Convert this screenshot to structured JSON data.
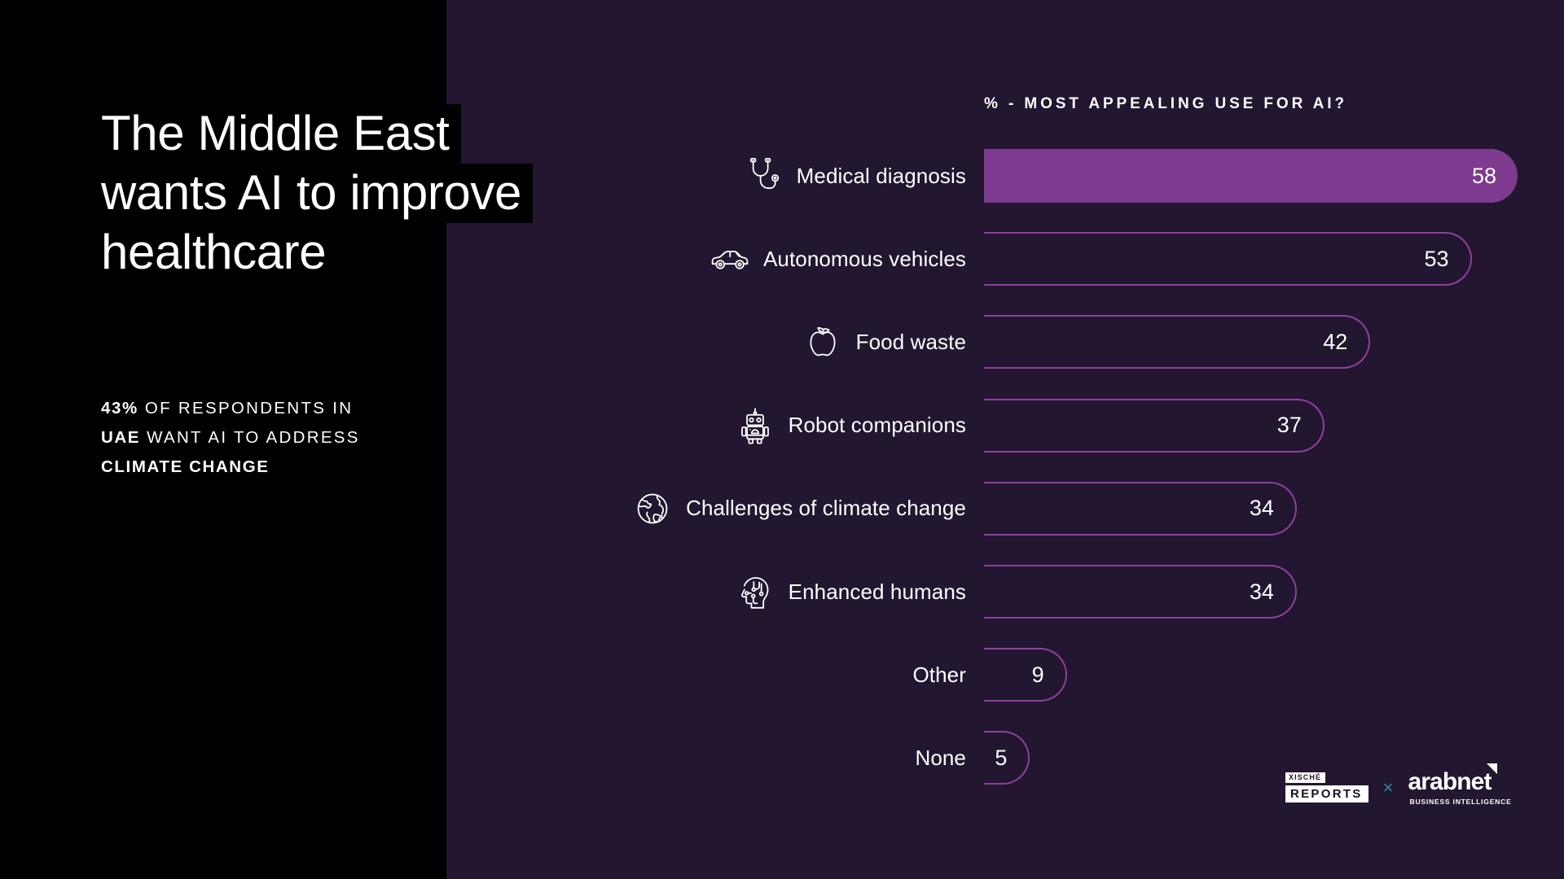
{
  "headline": {
    "lines": [
      "The Middle East",
      "wants AI to improve",
      "healthcare"
    ]
  },
  "subtitle": {
    "line1_bold": "43%",
    "line1_rest": " OF RESPONDENTS IN",
    "line2_bold": "UAE",
    "line2_rest": " WANT AI TO ADDRESS",
    "line3_bold": "CLIMATE CHANGE"
  },
  "logos": {
    "xische_top": "XISCHÉ",
    "xische_bottom": "REPORTS",
    "separator": "×",
    "arabnet_name": "arabnet",
    "arabnet_tagline": "BUSINESS INTELLIGENCE"
  },
  "colors": {
    "background": "#231630",
    "panel": "#000000",
    "bar_fill": "#7E3A8E",
    "bar_stroke": "#8E3F9E",
    "text": "#FFFFFF",
    "logo_x": "#2F8F9A"
  },
  "chart_data": {
    "type": "bar",
    "orientation": "horizontal",
    "title": "% - MOST APPEALING USE FOR AI?",
    "xlabel": "",
    "ylabel": "",
    "xlim": [
      0,
      58
    ],
    "grid": false,
    "legend": null,
    "unit": "%",
    "categories": [
      "Medical diagnosis",
      "Autonomous vehicles",
      "Food waste",
      "Robot companions",
      "Challenges of climate change",
      "Enhanced humans",
      "Other",
      "None"
    ],
    "values": [
      58,
      53,
      42,
      37,
      34,
      34,
      9,
      5
    ],
    "icons": [
      "stethoscope-icon",
      "car-icon",
      "apple-icon",
      "robot-icon",
      "globe-leaf-icon",
      "head-circuit-icon",
      null,
      null
    ],
    "highlighted_index": 0
  }
}
